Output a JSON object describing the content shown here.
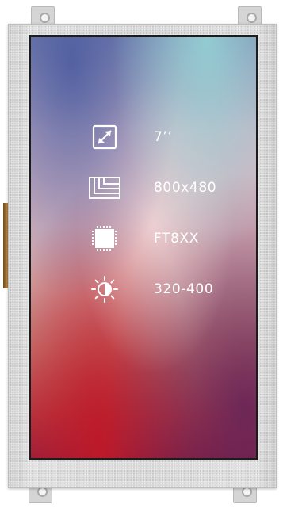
{
  "device": {
    "specs": [
      {
        "icon": "screen-size-icon",
        "value": "7’’"
      },
      {
        "icon": "resolution-icon",
        "value": "800x480"
      },
      {
        "icon": "chip-icon",
        "value": "FT8XX"
      },
      {
        "icon": "brightness-icon",
        "value": "320-400"
      }
    ]
  }
}
